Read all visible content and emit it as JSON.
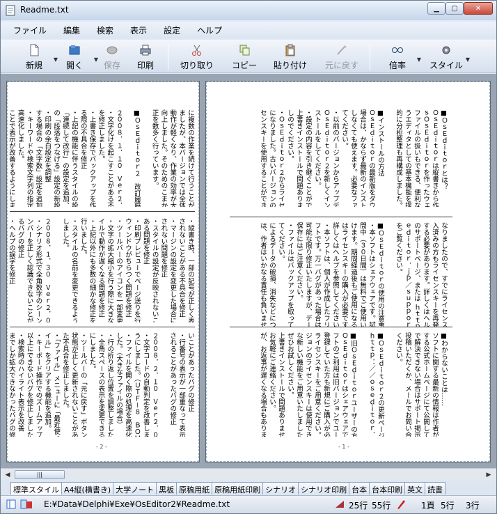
{
  "window": {
    "title": "Readme.txt"
  },
  "menu": [
    "ファイル",
    "編集",
    "検索",
    "表示",
    "設定",
    "ヘルプ"
  ],
  "toolbar": {
    "new": "新規",
    "open": "開く",
    "save": "保存",
    "print": "印刷",
    "cut": "切り取り",
    "copy": "コピー",
    "paste": "貼り付け",
    "undo": "元に戻す",
    "zoom": "倍率",
    "style": "スタイル"
  },
  "page_right": {
    "page_number": "- 1 -",
    "top": [
      "■ＯｓＥｄｉｔｏｒとは？",
      "ＯｓＥｄｉｔｏｒは縦書きから作り出した新し",
      "ｓＯｓＥｄｉｔｏｒを作ったウェブキャスター",
      "ファイルの扱いもできる、便利なエディタとし",
      "うエディタとしての基本機能を提供しています。",
      "的に分担整理も再構成しました。",
      "",
      "■インストールの方法",
      "ＯｓＥｄｉｔｏｒの最新版をダウンロードし",
      "場合は、かならず最新のインストーラを使",
      "しなくても使えます。必要なファイルを置く",
      "てください。",
      "・以前のバージョンからアップデートする場合",
      "ＯｓＥｄｉｔｏｒ２を新しくインストールして",
      "ストールをしてください。",
      "・設定の内容を引き継ぐことができます。",
      "上書きインストールで問題ありません。",
      "しのでください。",
      "・ＯｓＥｄｉｔｏｒ２からライセンスキーが変更",
      "になりました。古いバージョンのライ",
      "センスキーを使用することができません。"
    ],
    "middle": [
      "なりましたので、すでにライセンス購",
      "入済みの方もライセンスキーを再発行",
      "する必要があります。詳しくはヘルプ",
      "のサポートページ、または ｈｔｔｐ：／／ｏｓ",
      "ｅｄｉｔｏｒ．ｊｐ／ｓｕｐｐｏｒｔ／",
      "をご覧ください。",
      "",
      "■ＯｓＥｄｉｔｏｒの使用の注意事項",
      "・本ソフトはシェアウェアです。試用期",
      "間中（３０日間）は無料でご使用いただ",
      "けます。期間経過後もご使用になる場合",
      "はライセンスキーの購入が必要です。",
      "詳しくはヘルプを参照してください。",
      "・本ソフトは、個人が作成したフリーソ",
      "フトです。万一バグがあった場合は",
      "可能な限り修正いたしますが、データの",
      "保存にはご注意ください。",
      "・ファイルはバックアップを取っておい",
      "てください。",
      "によるデータの破損、消失などについて",
      "は、作者はいかなる責任も負いません。"
    ],
    "bottom": [
      "■わからないことは……",
      "ソフトに関する最新の情報は作者が運営",
      "する公式ホームページにて公開しています。",
      "で解決できない場合はサポート掲示板に",
      "投稿いただくか、メールでお問い合わせ",
      "ください。",
      "",
      "■ＯｓＥｄｉｔｏｒ２の更新ページ",
      "ｈｔｔｐ：／／ｏｓｅｄｉｔｏｒ．ｊｐ／",
      "",
      "■旧ＯｓＥｄｉｔｏｒユーザーの方へ",
      "ＯｓＥｄｉｔｏｒはシェアウェアです。",
      "フトのご利用は旧バージョンでユーザー",
      "登録していた方も新規にご購入が必要",
      "ライセンスキーをご用意ください。",
      "ジョンのライセンスキーは使用できません。",
      "な新しい機能をご用意いたしました。",
      "ぜひお試しください。",
      "上書きインストールで問題ありません。",
      "お気軽にご連絡ください。",
      "が、お返事が遅くなる場合もあります。"
    ]
  },
  "page_left": {
    "page_number": "- 2 -",
    "top": [
      "に複数の作業を続けて行うことができ",
      "ましたが、本バージョンでは全体的に",
      "動作が軽くなり、作業の効率が大幅に",
      "向上しました。そのためのこまかな修",
      "正を数多く行っています。",
      "",
      "■ＯｓＥｄｉｔｏｒ２　改訂履歴",
      "",
      "２００８．１．１０　Ｖｅｒ２．００",
      "・文字化けを起こすことがある不具合",
      "を修正しました。",
      "・上書き保存でバックアップを作成す",
      "る際の不具合を修正",
      "・上記の機能に伴うスタイルの設定で",
      "「連続して改行」の設定を追加、同様",
      "の「段落をつなげる」設定の新設、",
      "・印刷の余白設定を調整",
      "する場合の「文字数」設定を追加",
      "・キーワードや検索文字列の指定を",
      "高速化しました。",
      "ことで表示が改善するようにしました。"
    ],
    "middle": [
      "・縦書き時、一部の記号が正しく表示",
      "されないことがある不具合を修正",
      "・マージンの設定を変更した場合に表示",
      "されない問題を修正",
      "・スタイルの設定が反映されないことが",
      "ある問題を修正",
      "・印刷プレビューでページ送りを行うと",
      "ウィンドウがちらつく問題を修正",
      "・ツールバーのアイコンを一部変更",
      "・文字の拡大縮小を行う際に大きなファ",
      "イルで動作が遅くなる問題を修正",
      "・上記以外にも多数の細かな修正を",
      "行いました。",
      "・スタイルの名前を変更できるように",
      "しました。",
      "",
      "２００８．１．３０　Ｖｅｒ２．０１",
      "・シナリオ形式で全角数字のシーンナ",
      "ンバーを正しく認識できないことがあ",
      "るバグの修正",
      "・ヘルプの誤字を修正"
    ],
    "bottom": [
      "いことがあったバグの修正",
      "・行番号の表示が一部重なって表示",
      "されることがあったバグの修正",
      "",
      "２００８．２．１０　Ｖｅｒ２．０２",
      "・文字コードの自動判定を改善しました。",
      "うにしました。（ＵＴＦ－８　ＢＯＭなし）",
      "・ファイルを開く際の処理を高速化しま",
      "した。（大きなファイルの場合）",
      "・行の折り返し位置を調整しました。",
      "・全角スペースの表示を変更できるよう",
      "にしました。",
      "・ツールバーの「元に戻す」ボタンの",
      "状態が正しく更新されないことがあっ",
      "た不具合を修正しました。",
      "・「ファイル」メニューに「最近使ったファ",
      "イル」をクリアする機能を追加。",
      "・キーボード操作でのズームアップで３００％",
      "以上にできないバグを修正しました。",
      "・検索時のハイライト表示を改善",
      "までしか拡大できなかったバグの修正"
    ]
  },
  "tabs": [
    "標準スタイル",
    "A4縦(横書き)",
    "大学ノート",
    "黒板",
    "原稿用紙",
    "原稿用紙印刷",
    "シナリオ",
    "シナリオ印刷",
    "台本",
    "台本印刷",
    "英文",
    "読書"
  ],
  "status": {
    "path": "E:¥Data¥Delphi¥Exe¥OsEditor2¥Readme.txt",
    "lines": "25行",
    "cols": "55行",
    "page": "1頁",
    "row": "5行",
    "col": "3行"
  },
  "colors": {
    "highlight": "#f7b65a",
    "accent": "#3a6ea5"
  }
}
